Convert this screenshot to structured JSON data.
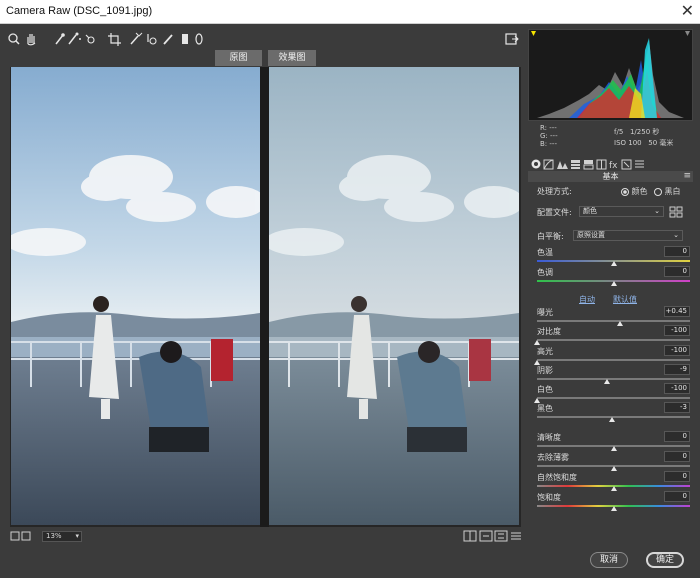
{
  "window": {
    "title": "Camera Raw (DSC_1091.jpg)"
  },
  "view_tabs": {
    "before": "原图",
    "after": "效果图"
  },
  "status": {
    "zoom": "13%"
  },
  "camera_info": {
    "r": "R:",
    "g": "G:",
    "b": "B:",
    "dash": "---",
    "aperture": "f/5",
    "shutter": "1/250 秒",
    "iso": "ISO 100",
    "focal": "50 毫米"
  },
  "panel": {
    "section_title": "基本",
    "treatment_label": "处理方式:",
    "treatment_color": "颜色",
    "treatment_bw": "黑白",
    "profile_label": "配置文件:",
    "profile_value": "颜色",
    "wb_label": "白平衡:",
    "wb_value": "原照设置",
    "auto": "自动",
    "default": "默认值",
    "sliders": {
      "temp": {
        "label": "色温",
        "value": "0",
        "level": 0.5
      },
      "tint": {
        "label": "色调",
        "value": "0",
        "level": 0.5
      },
      "exposure": {
        "label": "曝光",
        "value": "+0.45",
        "level": 0.54
      },
      "contrast": {
        "label": "对比度",
        "value": "-100",
        "level": 0.0
      },
      "highlights": {
        "label": "高光",
        "value": "-100",
        "level": 0.0
      },
      "shadows": {
        "label": "阴影",
        "value": "-9",
        "level": 0.46
      },
      "whites": {
        "label": "白色",
        "value": "-100",
        "level": 0.0
      },
      "blacks": {
        "label": "黑色",
        "value": "-3",
        "level": 0.49
      },
      "clarity": {
        "label": "清晰度",
        "value": "0",
        "level": 0.5
      },
      "dehaze": {
        "label": "去除薄雾",
        "value": "0",
        "level": 0.5
      },
      "vibrance": {
        "label": "自然饱和度",
        "value": "0",
        "level": 0.5
      },
      "saturation": {
        "label": "饱和度",
        "value": "0",
        "level": 0.5
      }
    }
  },
  "buttons": {
    "cancel": "取消",
    "ok": "确定"
  }
}
